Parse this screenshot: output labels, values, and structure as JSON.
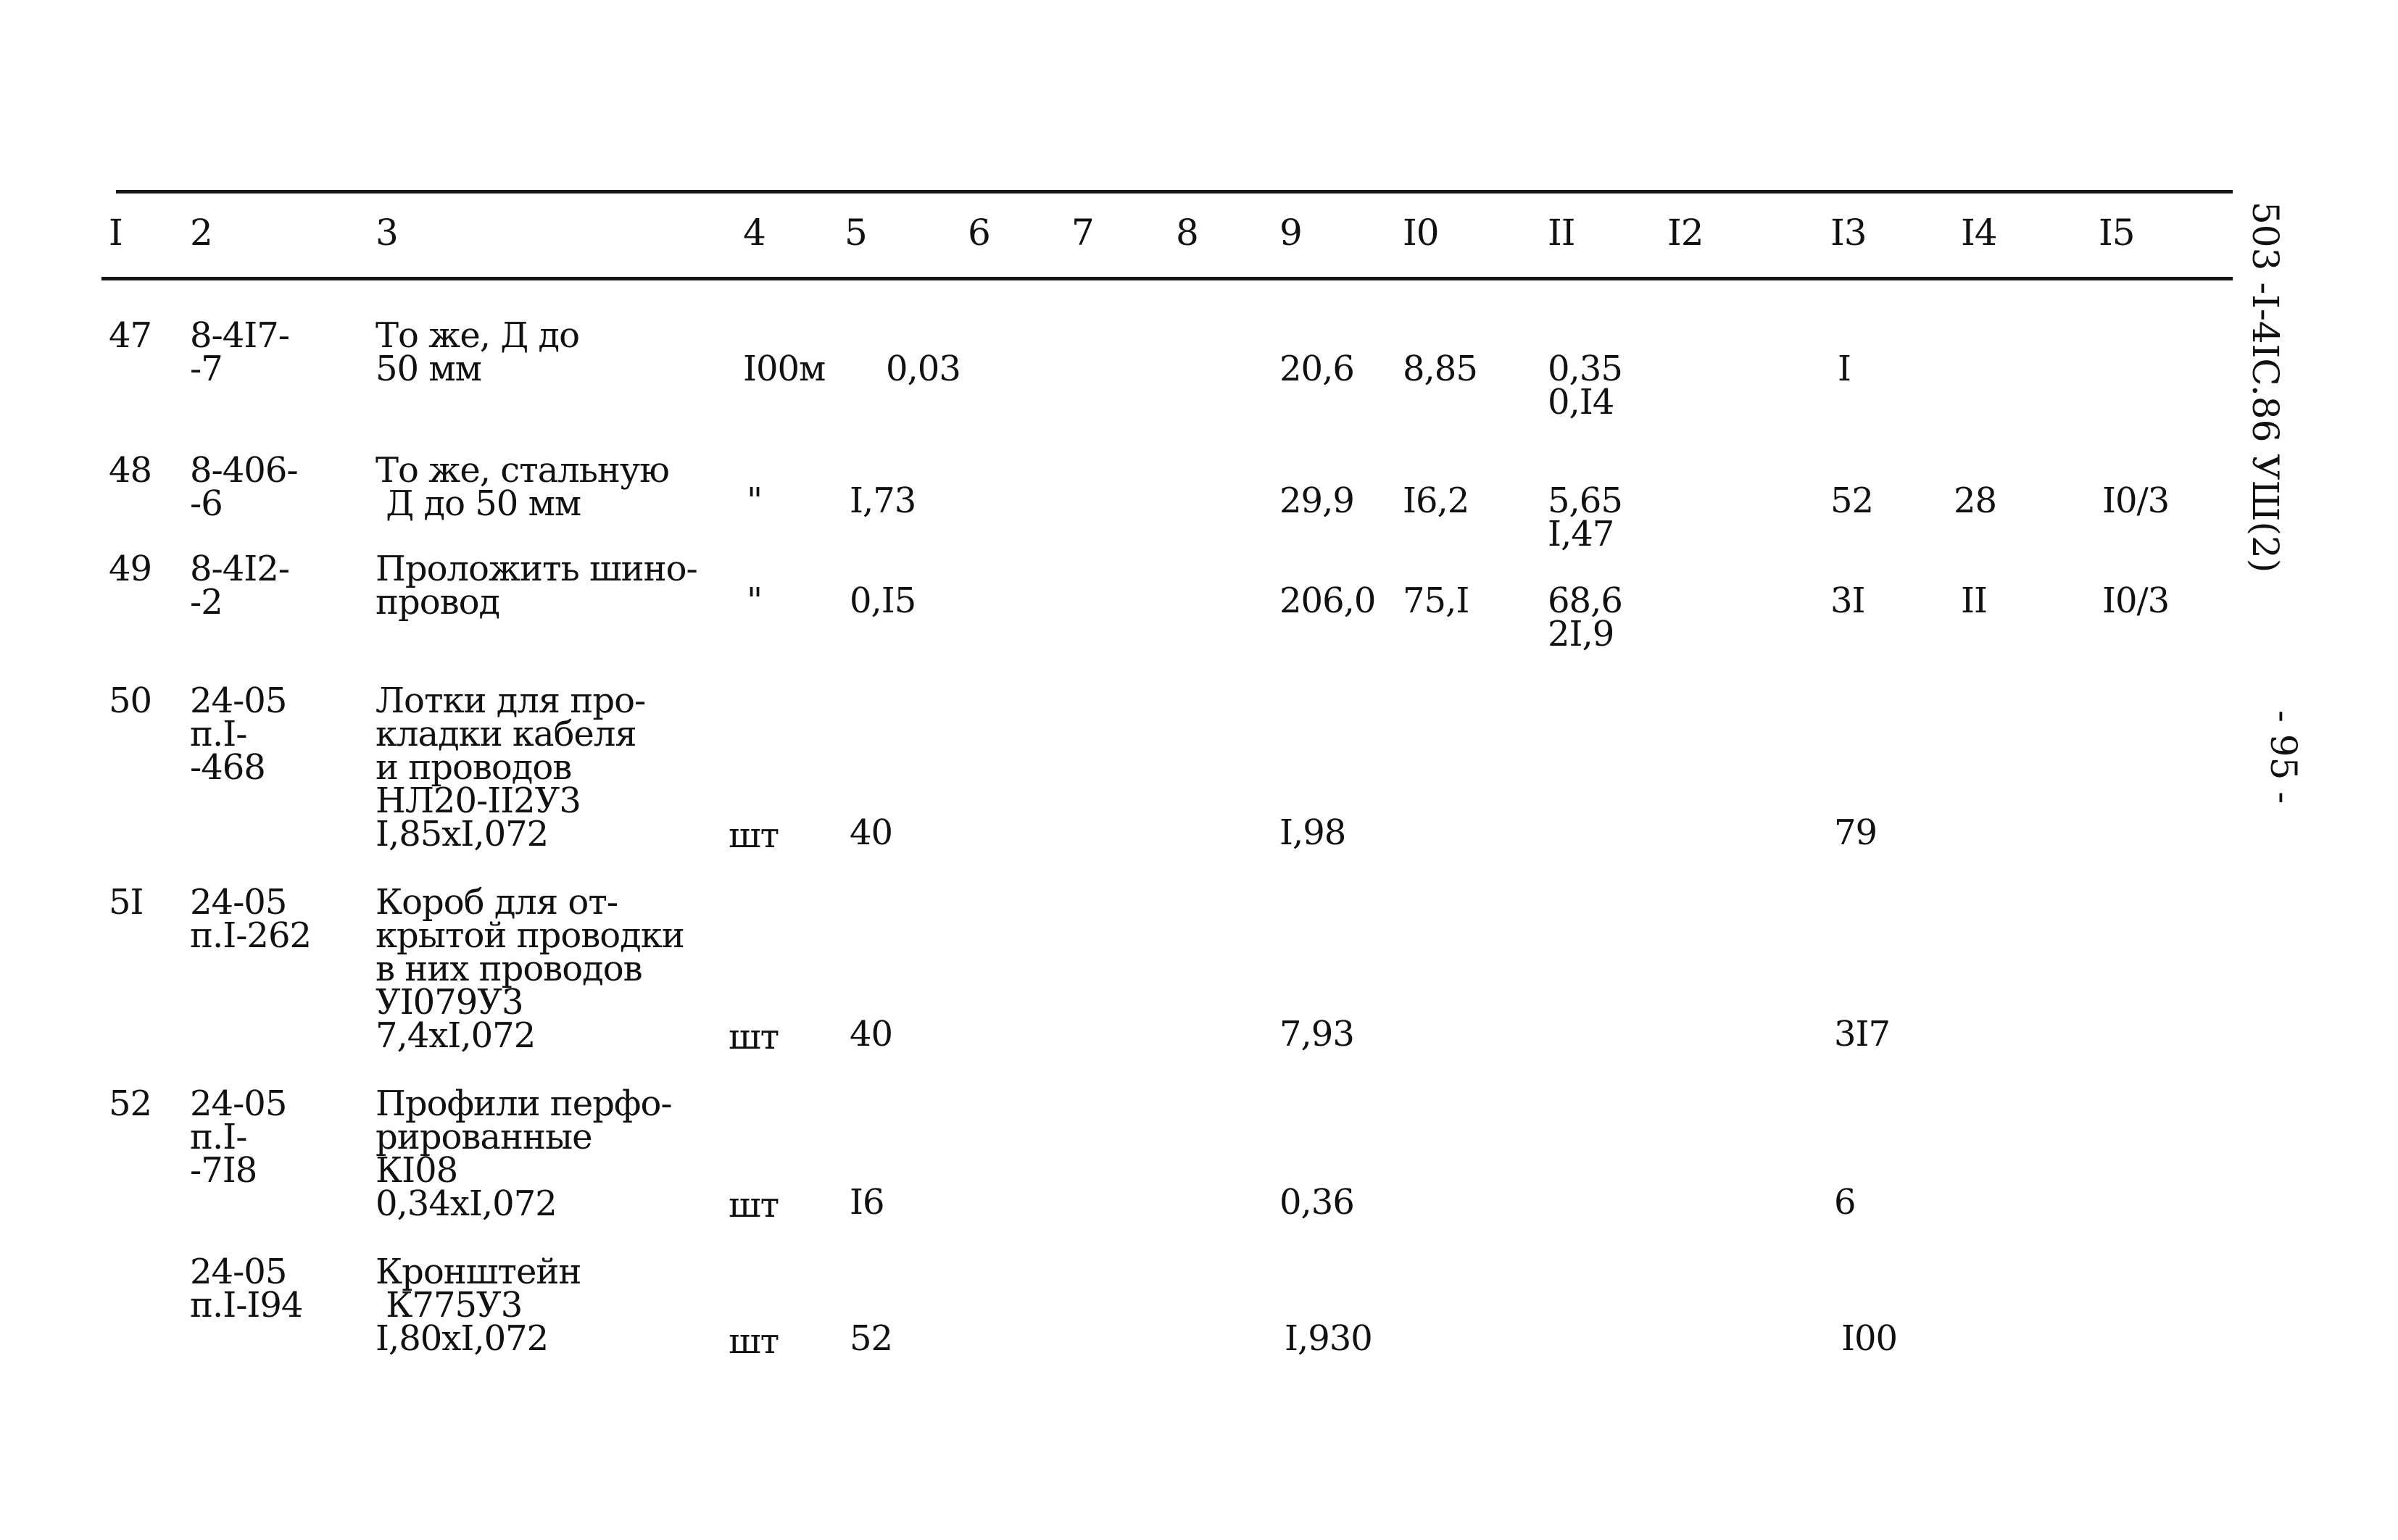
{
  "document": {
    "side_code": "503 -I-4IC.86 УШ(2)",
    "page_number": "- 95 -"
  },
  "table": {
    "column_headers": [
      "I",
      "2",
      "3",
      "4",
      "5",
      "6",
      "7",
      "8",
      "9",
      "I0",
      "II",
      "I2",
      "I3",
      "I4",
      "I5"
    ],
    "rows": [
      {
        "num": "47",
        "code": "8-4I7-\n-7",
        "name": "То же, Д до\n50 мм",
        "unit": "I00м",
        "c5": "0,03",
        "c9": "20,6",
        "c10": "8,85",
        "c11": "0,35\n0,I4",
        "c13": "I",
        "c14": "",
        "c15": ""
      },
      {
        "num": "48",
        "code": "8-406-\n-6",
        "name": "То же, стальную\n Д до 50 мм",
        "unit": "\"",
        "c5": "I,73",
        "c9": "29,9",
        "c10": "I6,2",
        "c11": "5,65\nI,47",
        "c13": "52",
        "c14": "28",
        "c15": "I0/3"
      },
      {
        "num": "49",
        "code": "8-4I2-\n-2",
        "name": "Проложить шино-\nпровод",
        "unit": "\"",
        "c5": "0,I5",
        "c9": "206,0",
        "c10": "75,I",
        "c11": "68,6\n2I,9",
        "c13": "3I",
        "c14": "II",
        "c15": "I0/3"
      },
      {
        "num": "50",
        "code": "24-05\nп.I-\n-468",
        "name": "Лотки для про-\nкладки кабеля\nи проводов\nНЛ20-II2У3\nI,85хI,072",
        "unit": "шт",
        "c5": "40",
        "c9": "I,98",
        "c10": "",
        "c11": "",
        "c13": "79",
        "c14": "",
        "c15": ""
      },
      {
        "num": "5I",
        "code": "24-05\nп.I-262",
        "name": "Короб для от-\nкрытой проводки\nв них проводов\nУI079У3\n7,4хI,072",
        "unit": "шт",
        "c5": "40",
        "c9": "7,93",
        "c10": "",
        "c11": "",
        "c13": "3I7",
        "c14": "",
        "c15": ""
      },
      {
        "num": "52",
        "code": "24-05\nп.I-\n-7I8",
        "name": "Профили перфо-\nрированные\nКI08\n0,34хI,072",
        "unit": "шт",
        "c5": "I6",
        "c9": "0,36",
        "c10": "",
        "c11": "",
        "c13": "6",
        "c14": "",
        "c15": ""
      },
      {
        "num": "",
        "code": "24-05\nп.I-I94",
        "name": "Кронштейн\n К775У3\nI,80хI,072",
        "unit": "шт",
        "c5": "52",
        "c9": "I,930",
        "c10": "",
        "c11": "",
        "c13": "I00",
        "c14": "",
        "c15": ""
      }
    ]
  }
}
